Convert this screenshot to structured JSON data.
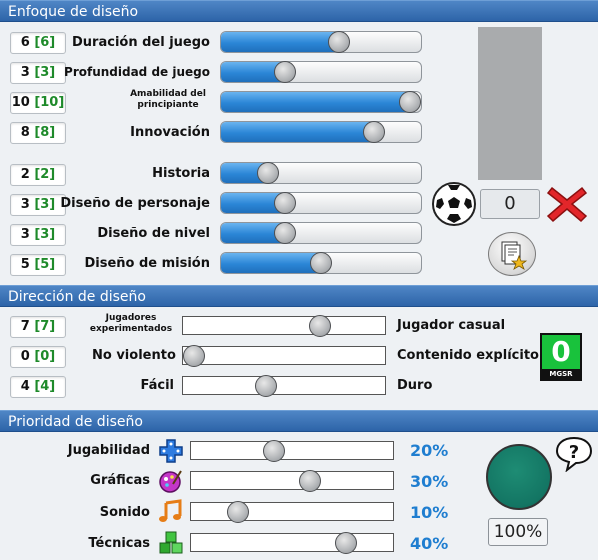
{
  "design_focus": {
    "header": "Enfoque de diseño",
    "rows": [
      {
        "value": "6",
        "preview": "[6]",
        "label": "Duración del juego",
        "level": 0.6
      },
      {
        "value": "3",
        "preview": "[3]",
        "label": "Profundidad de juego",
        "level": 0.3
      },
      {
        "value": "10",
        "preview": "[10]",
        "label": "Amabilidad del principiante",
        "level": 1.0
      },
      {
        "value": "8",
        "preview": "[8]",
        "label": "Innovación",
        "level": 0.8
      },
      {
        "value": "2",
        "preview": "[2]",
        "label": "Historia",
        "level": 0.2
      },
      {
        "value": "3",
        "preview": "[3]",
        "label": "Diseño de personaje",
        "level": 0.3
      },
      {
        "value": "3",
        "preview": "[3]",
        "label": "Diseño de nivel",
        "level": 0.3
      },
      {
        "value": "5",
        "preview": "[5]",
        "label": "Diseño de misión",
        "level": 0.5
      }
    ],
    "counter": "0"
  },
  "design_direction": {
    "header": "Dirección de diseño",
    "rows": [
      {
        "value": "7",
        "preview": "[7]",
        "left_label": "Jugadores experimentados",
        "right_label": "Jugador casual",
        "level": 0.7
      },
      {
        "value": "0",
        "preview": "[0]",
        "left_label": "No violento",
        "right_label": "Contenido explícito",
        "level": 0.0
      },
      {
        "value": "4",
        "preview": "[4]",
        "left_label": "Fácil",
        "right_label": "Duro",
        "level": 0.4
      }
    ],
    "rating": {
      "value": "0",
      "label": "MGSR"
    }
  },
  "design_priority": {
    "header": "Prioridad de diseño",
    "rows": [
      {
        "label": "Jugabilidad",
        "percent": "20%",
        "icon": "gamepad-icon",
        "level": 0.4
      },
      {
        "label": "Gráficas",
        "percent": "30%",
        "icon": "palette-icon",
        "level": 0.6
      },
      {
        "label": "Sonido",
        "percent": "10%",
        "icon": "music-note-icon",
        "level": 0.2
      },
      {
        "label": "Técnicas",
        "percent": "40%",
        "icon": "cubes-icon",
        "level": 0.8
      }
    ],
    "total": "100%"
  }
}
